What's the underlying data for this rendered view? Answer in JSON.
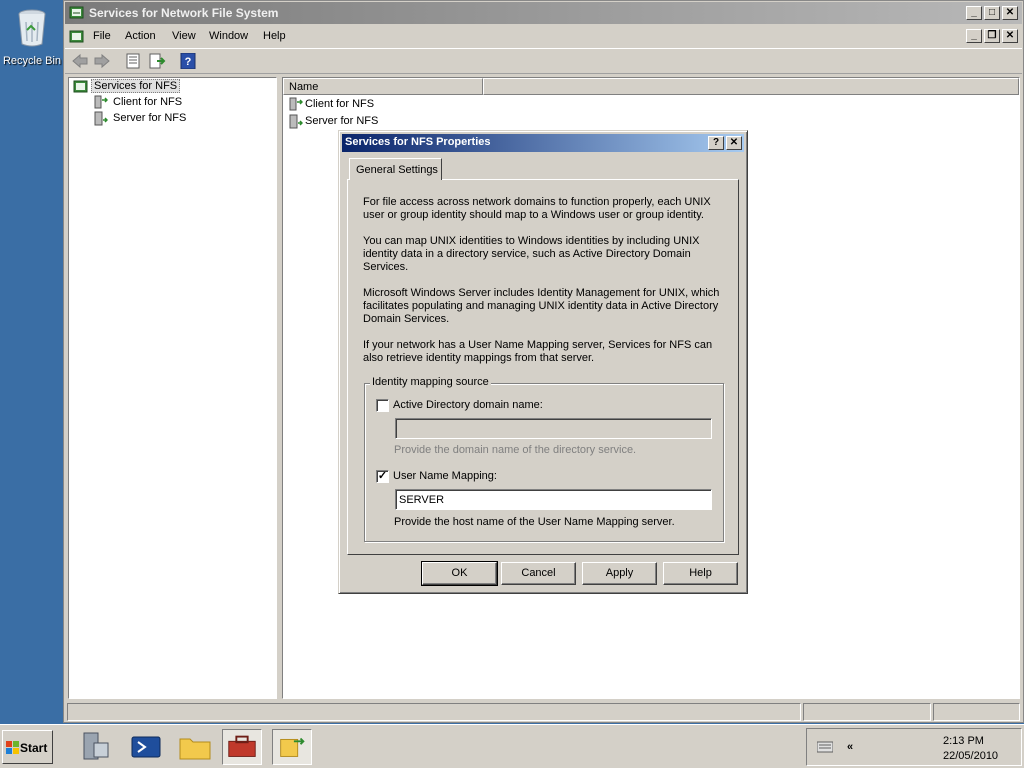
{
  "desktop": {
    "recycle_bin_label": "Recycle Bin"
  },
  "window": {
    "title": "Services for Network File System",
    "menu": [
      "File",
      "Action",
      "View",
      "Window",
      "Help"
    ]
  },
  "tree": {
    "root": "Services for NFS",
    "children": [
      "Client for NFS",
      "Server for NFS"
    ]
  },
  "list": {
    "column_name": "Name",
    "items": [
      "Client for NFS",
      "Server for NFS"
    ]
  },
  "dialog": {
    "title": "Services for NFS Properties",
    "help_glyph": "?",
    "close_glyph": "✕",
    "tab": "General Settings",
    "paragraphs": [
      "For file access across network domains to function properly, each UNIX user or group identity should map to a Windows user or group identity.",
      "You can map UNIX identities to Windows identities by including UNIX identity data in a directory service, such as Active Directory Domain Services.",
      "Microsoft Windows Server includes Identity Management for UNIX, which facilitates populating and managing UNIX identity data in Active Directory Domain Services.",
      "If your network has a User Name Mapping server, Services for NFS can also retrieve identity mappings from that server."
    ],
    "group_label": "Identity mapping source",
    "ad_checkbox_label": "Active Directory domain name:",
    "ad_checked": false,
    "ad_value": "",
    "ad_hint": "Provide the domain name of the directory service.",
    "unm_checkbox_label": "User Name Mapping:",
    "unm_checked": true,
    "unm_value": "SERVER",
    "unm_hint": "Provide the host name of the User Name Mapping server.",
    "buttons": {
      "ok": "OK",
      "cancel": "Cancel",
      "apply": "Apply",
      "help": "Help"
    }
  },
  "taskbar": {
    "start_label": "Start",
    "clock_time": "2:13 PM",
    "clock_date": "22/05/2010"
  },
  "colors": {
    "desktop": "#3a6ea5",
    "dialog_title": "#0a246a",
    "chrome": "#d4d0c8"
  }
}
